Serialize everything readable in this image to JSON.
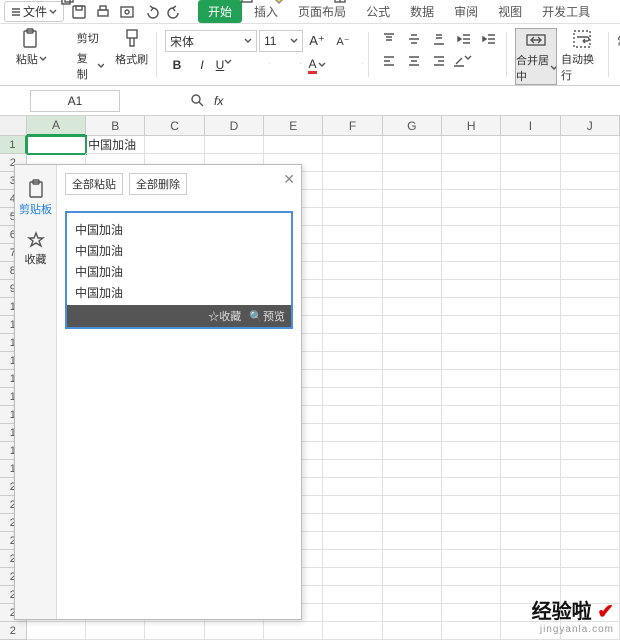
{
  "menubar": {
    "file": "文件"
  },
  "tabs": {
    "start": "开始",
    "insert": "插入",
    "pagelayout": "页面布局",
    "formula": "公式",
    "data": "数据",
    "review": "审阅",
    "view": "视图",
    "devtools": "开发工具"
  },
  "ribbon": {
    "paste": "粘贴",
    "cut": "剪切",
    "copy": "复制",
    "format_painter": "格式刷",
    "font_name": "宋体",
    "font_size": "11",
    "merge_center": "合并居中",
    "wrap_text": "自动换行",
    "general": "常规"
  },
  "formula_bar": {
    "name_box": "A1",
    "fx": "fx",
    "value": ""
  },
  "columns": [
    "A",
    "B",
    "C",
    "D",
    "E",
    "F",
    "G",
    "H",
    "I",
    "J"
  ],
  "grid": {
    "b1": "中国加油"
  },
  "clipboard": {
    "side_tab1": "剪贴板",
    "side_tab2": "收藏",
    "paste_all": "全部粘贴",
    "delete_all": "全部删除",
    "items": [
      "中国加油",
      "中国加油",
      "中国加油",
      "中国加油"
    ],
    "fav_action": "☆收藏",
    "preview_action": "预览"
  },
  "watermark": {
    "title": "经验啦",
    "url": "jingyanla.com"
  }
}
